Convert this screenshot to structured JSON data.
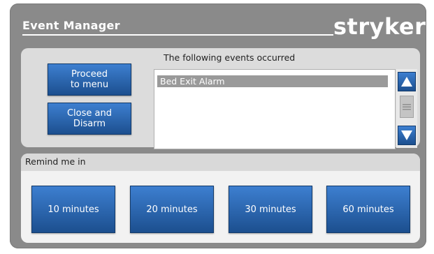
{
  "header": {
    "title": "Event Manager",
    "brand": "stryker"
  },
  "actions": {
    "proceed_label_line1": "Proceed",
    "proceed_label_line2": "to menu",
    "close_label_line1": "Close and",
    "close_label_line2": "Disarm"
  },
  "events": {
    "header": "The following events occurred",
    "items": [
      "Bed Exit Alarm"
    ]
  },
  "remind": {
    "label": "Remind me in",
    "options": [
      "10 minutes",
      "20 minutes",
      "30 minutes",
      "60 minutes"
    ]
  },
  "icons": {
    "scroll_up": "triangle-up-icon",
    "scroll_down": "triangle-down-icon",
    "scroll_thumb": "grip-lines-icon"
  },
  "colors": {
    "accent": "#2f6fbf",
    "background": "#8a8a8a"
  }
}
